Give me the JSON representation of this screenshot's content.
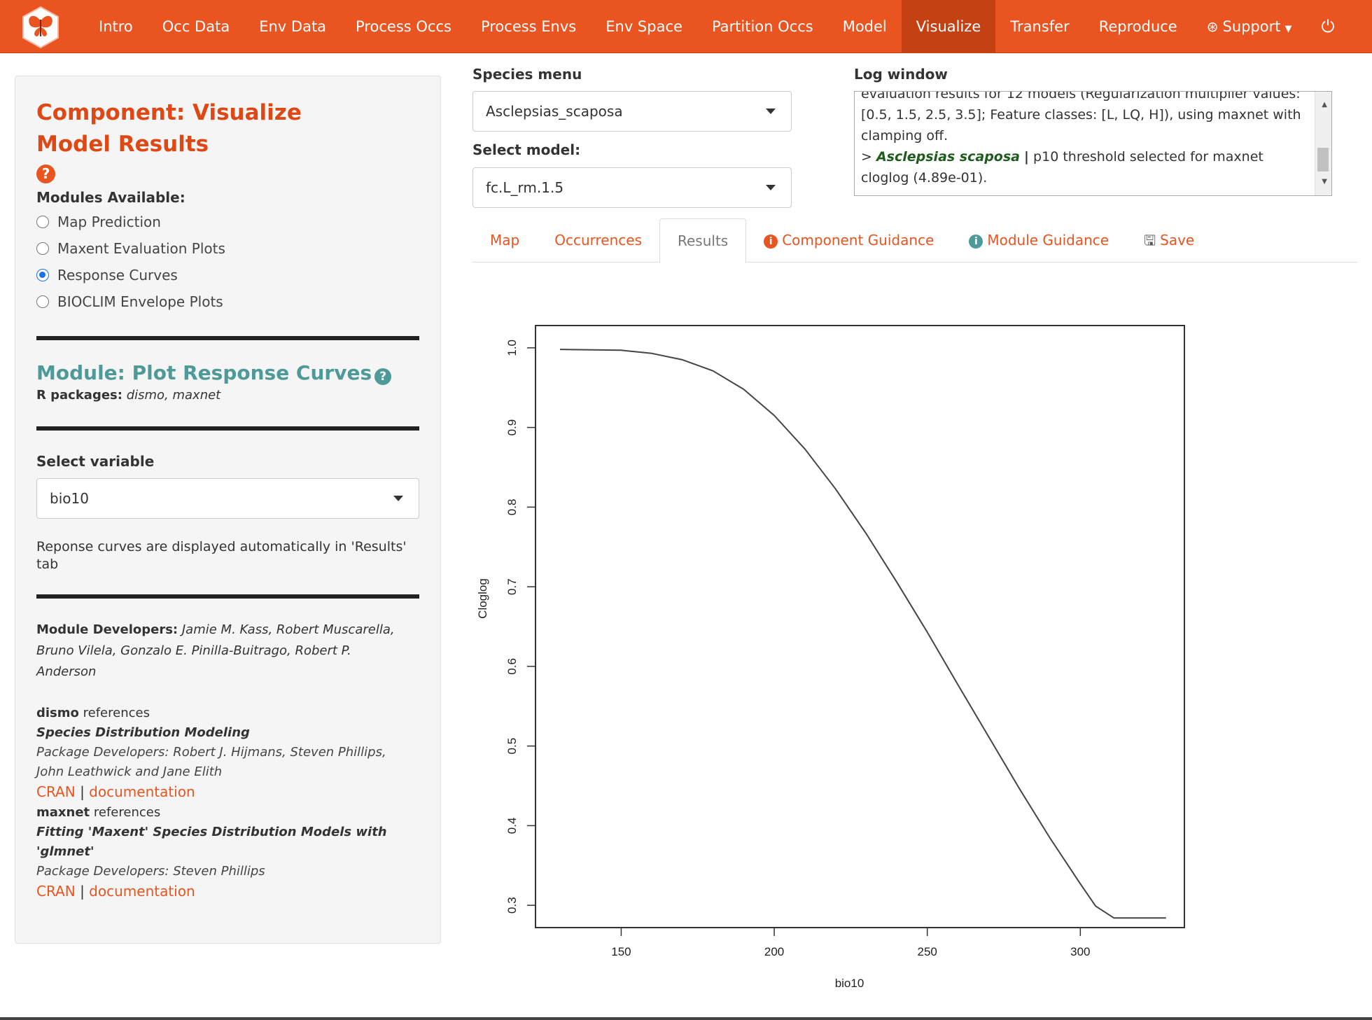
{
  "navbar": {
    "items": [
      "Intro",
      "Occ Data",
      "Env Data",
      "Process Occs",
      "Process Envs",
      "Env Space",
      "Partition Occs",
      "Model",
      "Visualize",
      "Transfer",
      "Reproduce"
    ],
    "active": "Visualize",
    "support_label": "Support",
    "accent_color": "#e95420"
  },
  "sidebar": {
    "component_title": "Component: Visualize Model Results",
    "help_glyph": "?",
    "modules_label": "Modules Available:",
    "modules": [
      {
        "label": "Map Prediction",
        "checked": false
      },
      {
        "label": "Maxent Evaluation Plots",
        "checked": false
      },
      {
        "label": "Response Curves",
        "checked": true
      },
      {
        "label": "BIOCLIM Envelope Plots",
        "checked": false
      }
    ],
    "module_title": "Module: Plot Response Curves",
    "r_packages_label": "R packages:",
    "r_packages": "dismo, maxnet",
    "select_variable_label": "Select variable",
    "select_variable_value": "bio10",
    "response_note": "Reponse curves are displayed automatically in 'Results' tab",
    "developers_label": "Module Developers:",
    "developers": "Jamie M. Kass, Robert Muscarella, Bruno Vilela, Gonzalo E. Pinilla-Buitrago, Robert P. Anderson",
    "references": [
      {
        "pkg": "dismo",
        "suffix": "references",
        "title": "Species Distribution Modeling",
        "devs": "Package Developers: Robert J. Hijmans, Steven Phillips, John Leathwick and Jane Elith",
        "cran": "CRAN",
        "sep": "|",
        "doc": "documentation"
      },
      {
        "pkg": "maxnet",
        "suffix": "references",
        "title": "Fitting 'Maxent' Species Distribution Models with 'glmnet'",
        "devs": "Package Developers: Steven Phillips",
        "cran": "CRAN",
        "sep": "|",
        "doc": "documentation"
      }
    ]
  },
  "species_menu": {
    "label": "Species menu",
    "value": "Asclepsias_scaposa"
  },
  "select_model": {
    "label": "Select model:",
    "value": "fc.L_rm.1.5"
  },
  "log_window": {
    "label": "Log window",
    "line1": "evaluation results for 12 models (Regularization multiplier values: [0.5, 1.5, 2.5, 3.5]; Feature classes: [L, LQ, H]), using maxnet with clamping off.",
    "line2_prefix": ">",
    "line2_species": "Asclepsias scaposa",
    "line2_sep": "|",
    "line2_rest": "p10 threshold selected for maxnet cloglog (4.89e-01)."
  },
  "tabs": {
    "map": "Map",
    "occurrences": "Occurrences",
    "results": "Results",
    "component_guidance": "Component Guidance",
    "module_guidance": "Module Guidance",
    "save": "Save",
    "active": "Results"
  },
  "chart_data": {
    "type": "line",
    "xlabel": "bio10",
    "ylabel": "Cloglog",
    "xlim": [
      122,
      334
    ],
    "ylim": [
      0.272,
      1.028
    ],
    "xticks": [
      150,
      200,
      250,
      300
    ],
    "yticks": [
      0.3,
      0.4,
      0.5,
      0.6,
      0.7,
      0.8,
      0.9,
      1.0
    ],
    "ytick_labels": [
      "0.3",
      "0.4",
      "0.5",
      "0.6",
      "0.7",
      "0.8",
      "0.9",
      "1.0"
    ],
    "grid": false,
    "series": [
      {
        "x": [
          130,
          150,
          160,
          170,
          180,
          190,
          200,
          210,
          220,
          230,
          240,
          250,
          260,
          270,
          280,
          290,
          300,
          305,
          311,
          320,
          328
        ],
        "y": [
          0.998,
          0.997,
          0.993,
          0.985,
          0.971,
          0.948,
          0.915,
          0.873,
          0.823,
          0.767,
          0.706,
          0.643,
          0.577,
          0.512,
          0.447,
          0.385,
          0.327,
          0.299,
          0.284,
          0.284,
          0.284
        ]
      }
    ]
  }
}
